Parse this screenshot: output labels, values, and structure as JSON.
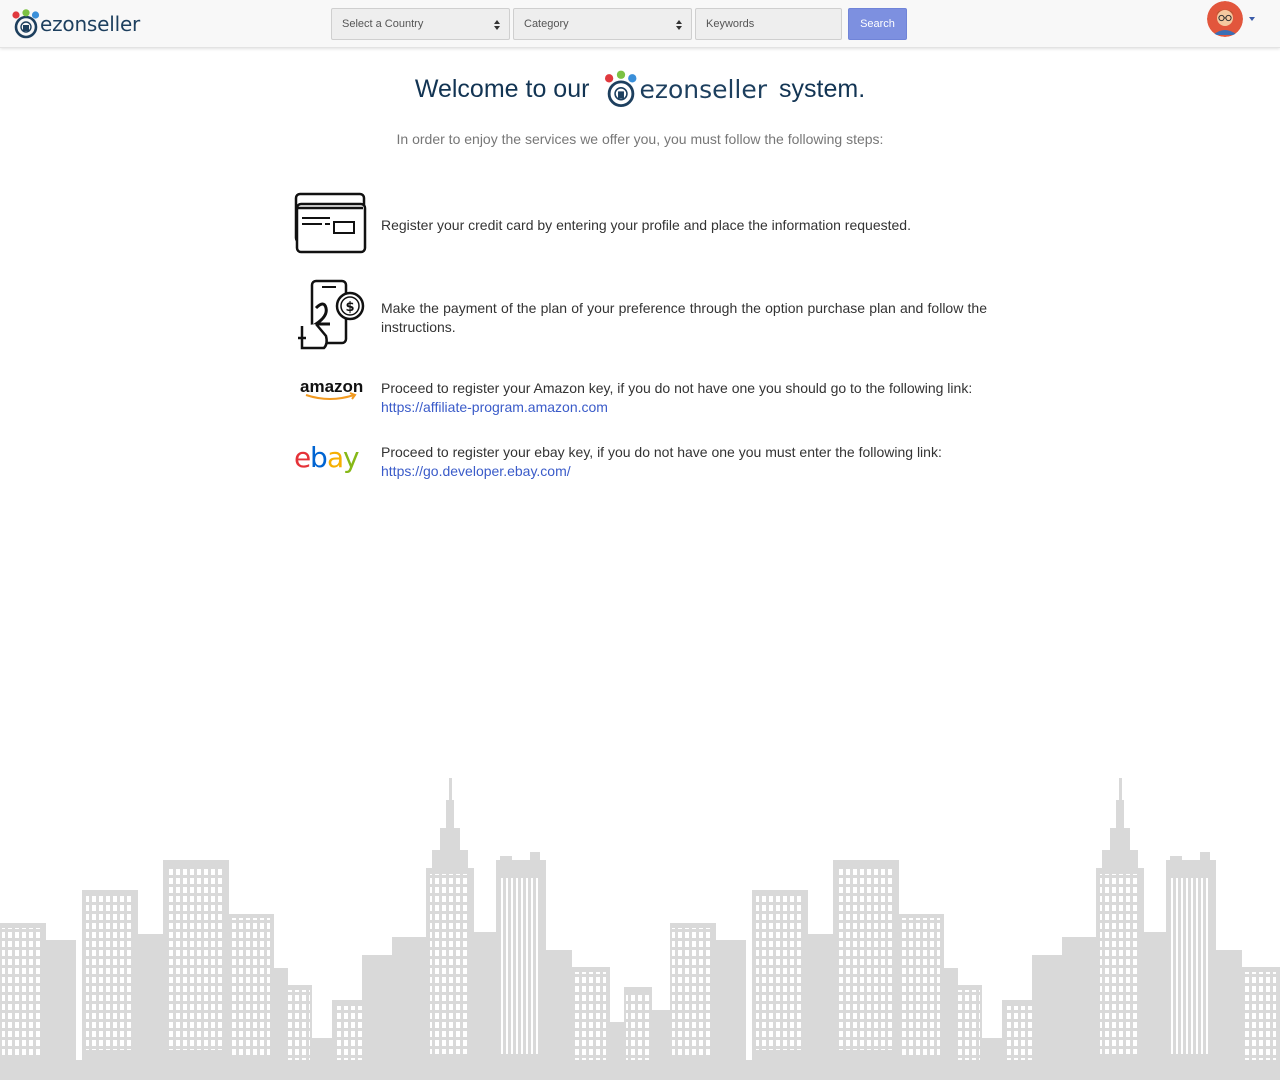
{
  "header": {
    "logo_text": "ezonseller",
    "country_select": "Select a Country",
    "category_select": "Category",
    "keywords_placeholder": "Keywords",
    "search_label": "Search"
  },
  "welcome": {
    "prefix": "Welcome to our",
    "brand": "ezonseller",
    "suffix": "system.",
    "subtitle": "In order to enjoy the services we offer you, you must follow the following steps:"
  },
  "steps": [
    {
      "icon": "credit-card-icon",
      "text": "Register your credit card by entering your profile and place the information requested."
    },
    {
      "icon": "mobile-payment-icon",
      "text": "Make the payment of the plan of your preference through the option purchase plan and follow the instructions."
    },
    {
      "icon": "amazon-logo",
      "logo_text": "amazon",
      "text": "Proceed to register your Amazon key, if you do not have one you should go to the following link:",
      "link": "https://affiliate-program.amazon.com"
    },
    {
      "icon": "ebay-logo",
      "logo_text": "ebay",
      "text": "Proceed to register your ebay key, if you do not have one you must enter the following link:",
      "link": "https://go.developer.ebay.com/"
    }
  ],
  "colors": {
    "accent": "#7d90e0",
    "link": "#3a5bc9",
    "heading": "#123453",
    "skyline": "#d9d9d9"
  }
}
